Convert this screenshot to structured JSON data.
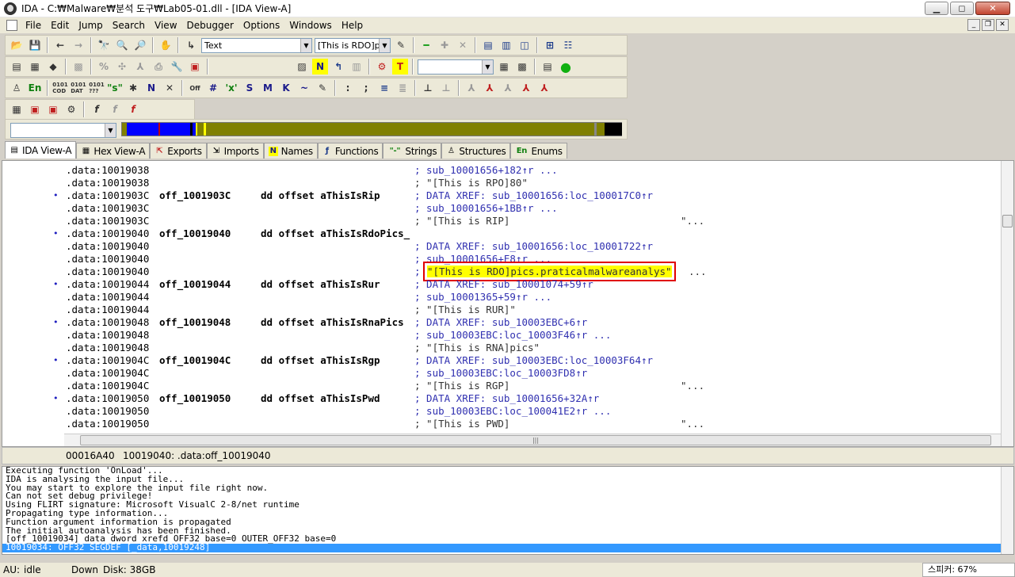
{
  "window": {
    "title": "IDA - C:₩Malware₩분석 도구₩Lab05-01.dll - [IDA View-A]",
    "min_label": "▁",
    "max_label": "◻",
    "close_label": "✕"
  },
  "menu": [
    "File",
    "Edit",
    "Jump",
    "Search",
    "View",
    "Debugger",
    "Options",
    "Windows",
    "Help"
  ],
  "toolbar": {
    "type_combo": "Text",
    "search_combo": "[This is RDO]pi"
  },
  "tabs": [
    "IDA View-A",
    "Hex View-A",
    "Exports",
    "Imports",
    "Names",
    "Functions",
    "Strings",
    "Structures",
    "Enums"
  ],
  "lines": [
    {
      "bullet": "",
      "addr": ".data:10019038",
      "label": "",
      "instr": "",
      "cmt": "; sub_10001656+182↑r ...",
      "tail": ""
    },
    {
      "bullet": "",
      "addr": ".data:10019038",
      "label": "",
      "instr": "",
      "cmt": "; \"[This is RPO]80\"",
      "tail": ""
    },
    {
      "bullet": "•",
      "addr": ".data:1001903C",
      "label": "off_1001903C",
      "instr": "dd offset aThisIsRip",
      "cmt": "; DATA XREF: sub_10001656:loc_100017C0↑r",
      "tail": ""
    },
    {
      "bullet": "",
      "addr": ".data:1001903C",
      "label": "",
      "instr": "",
      "cmt": "; sub_10001656+1BB↑r ...",
      "tail": ""
    },
    {
      "bullet": "",
      "addr": ".data:1001903C",
      "label": "",
      "instr": "",
      "cmt": "; \"[This is RIP]",
      "tail": "\"..."
    },
    {
      "bullet": "•",
      "addr": ".data:10019040",
      "label": "off_10019040",
      "instr": "dd offset aThisIsRdoPics_",
      "cmt": "",
      "tail": ""
    },
    {
      "bullet": "",
      "addr": ".data:10019040",
      "label": "",
      "instr": "",
      "cmt": "; DATA XREF: sub_10001656:loc_10001722↑r",
      "tail": ""
    },
    {
      "bullet": "",
      "addr": ".data:10019040",
      "label": "",
      "instr": "",
      "cmt": "; sub_10001656+E8↑r ...",
      "tail": ""
    },
    {
      "bullet": "",
      "addr": ".data:10019040",
      "label": "",
      "instr": "",
      "cmt": "; ",
      "hl": "\"[This is RDO]pics.praticalmalwareanalys\"",
      "tail": "..."
    },
    {
      "bullet": "•",
      "addr": ".data:10019044",
      "label": "off_10019044",
      "instr": "dd offset aThisIsRur",
      "cmt": "; DATA XREF: sub_10001074+59↑r",
      "tail": ""
    },
    {
      "bullet": "",
      "addr": ".data:10019044",
      "label": "",
      "instr": "",
      "cmt": "; sub_10001365+59↑r ...",
      "tail": ""
    },
    {
      "bullet": "",
      "addr": ".data:10019044",
      "label": "",
      "instr": "",
      "cmt": "; \"[This is RUR]\"",
      "tail": ""
    },
    {
      "bullet": "•",
      "addr": ".data:10019048",
      "label": "off_10019048",
      "instr": "dd offset aThisIsRnaPics",
      "cmt": "; DATA XREF: sub_10003EBC+6↑r",
      "tail": ""
    },
    {
      "bullet": "",
      "addr": ".data:10019048",
      "label": "",
      "instr": "",
      "cmt": "; sub_10003EBC:loc_10003F46↑r ...",
      "tail": ""
    },
    {
      "bullet": "",
      "addr": ".data:10019048",
      "label": "",
      "instr": "",
      "cmt": "; \"[This is RNA]pics\"",
      "tail": ""
    },
    {
      "bullet": "•",
      "addr": ".data:1001904C",
      "label": "off_1001904C",
      "instr": "dd offset aThisIsRgp",
      "cmt": "; DATA XREF: sub_10003EBC:loc_10003F64↑r",
      "tail": ""
    },
    {
      "bullet": "",
      "addr": ".data:1001904C",
      "label": "",
      "instr": "",
      "cmt": "; sub_10003EBC:loc_10003FD8↑r",
      "tail": ""
    },
    {
      "bullet": "",
      "addr": ".data:1001904C",
      "label": "",
      "instr": "",
      "cmt": "; \"[This is RGP]",
      "tail": "\"..."
    },
    {
      "bullet": "•",
      "addr": ".data:10019050",
      "label": "off_10019050",
      "instr": "dd offset aThisIsPwd",
      "cmt": "; DATA XREF: sub_10001656+32A↑r",
      "tail": ""
    },
    {
      "bullet": "",
      "addr": ".data:10019050",
      "label": "",
      "instr": "",
      "cmt": "; sub_10003EBC:loc_100041E2↑r ...",
      "tail": ""
    },
    {
      "bullet": "",
      "addr": ".data:10019050",
      "label": "",
      "instr": "",
      "cmt": "; \"[This is PWD]",
      "tail": "\"..."
    }
  ],
  "status": {
    "offset": "00016A40",
    "location": "10019040: .data:off_10019040"
  },
  "output": [
    "Executing function 'OnLoad'...",
    "IDA is analysing the input file...",
    "You may start to explore the input file right now.",
    "Can not set debug privilege!",
    "Using FLIRT signature: Microsoft VisualC 2-8/net runtime",
    "Propagating type information...",
    "Function argument information is propagated",
    "The initial autoanalysis has been finished.",
    "[off_10019034] data dword xrefd OFF32 base=0 OUTER_OFF32 base=0"
  ],
  "output_selected": "10019034: OFF32 SEGDEF [_data,10019248]",
  "bottom": {
    "au": "AU:",
    "state": "idle",
    "dir": "Down",
    "disk": "Disk: 38GB"
  },
  "ime": "스피커: 67%",
  "colors": {
    "comment": "#3030b0",
    "highlight": "#ffff00",
    "selection": "#3399ff"
  }
}
